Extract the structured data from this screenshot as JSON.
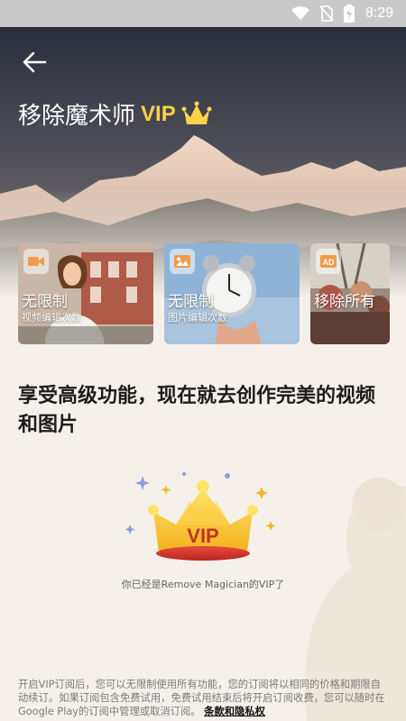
{
  "status_bar": {
    "time": "8:29",
    "icons": [
      "wifi-icon",
      "no-sim-icon",
      "battery-charging-icon"
    ]
  },
  "header": {
    "back_icon": "back-arrow-icon",
    "title": "移除魔术师",
    "vip_label": "VIP",
    "crown_icon": "crown-icon"
  },
  "cards": [
    {
      "icon": "video-camera-icon",
      "title": "无限制",
      "subtitle": "视频编辑次数"
    },
    {
      "icon": "image-icon",
      "title": "无限制",
      "subtitle": "图片编辑次数"
    },
    {
      "icon": "ad-icon",
      "title": "移除所有",
      "subtitle": ""
    }
  ],
  "headline": "享受高级功能，现在就去创作完美的视频和图片",
  "vip_badge": {
    "crown_text": "VIP"
  },
  "member_text": "你已经是Remove Magician的VIP了",
  "footer": {
    "text": "开启VIP订阅后，您可以无限制使用所有功能，您的订阅将以相同的价格和期限自动续订。如果订阅包含免费试用，免费试用结束后将开启订阅收费，您可以随时在Google Play的订阅中管理或取消订阅。",
    "link_label": "条款和隐私权"
  },
  "colors": {
    "vip_gold": "#ffd24a",
    "background": "#f5f1ea"
  }
}
